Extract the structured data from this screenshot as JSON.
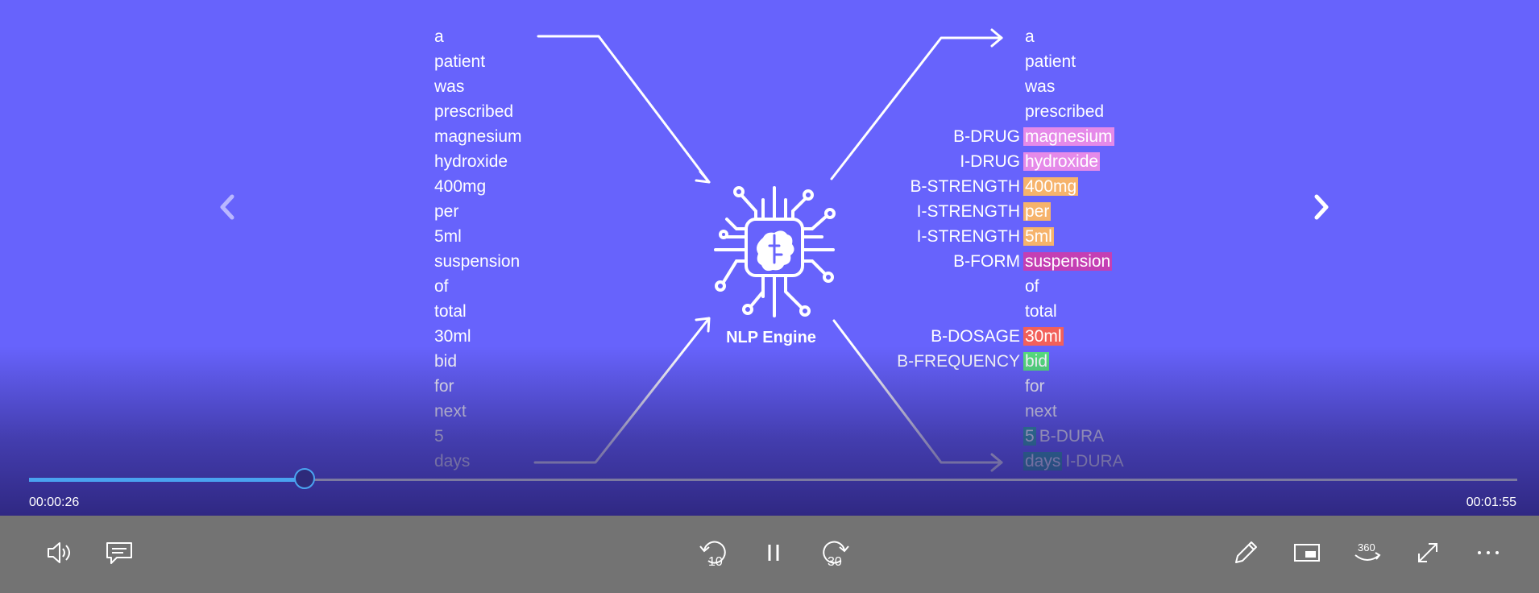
{
  "input_tokens": [
    "a",
    "patient",
    "was",
    "prescribed",
    "magnesium",
    "hydroxide",
    "400mg",
    "per",
    "5ml",
    "suspension",
    "of",
    "total",
    "30ml",
    "bid",
    "for",
    "next",
    "5",
    "days"
  ],
  "output_rows": [
    {
      "token": "a",
      "tag": "",
      "hl": "none",
      "tag_position": "left"
    },
    {
      "token": "patient",
      "tag": "",
      "hl": "none",
      "tag_position": "left"
    },
    {
      "token": "was",
      "tag": "",
      "hl": "none",
      "tag_position": "left"
    },
    {
      "token": "prescribed",
      "tag": "",
      "hl": "none",
      "tag_position": "left"
    },
    {
      "token": "magnesium",
      "tag": "B-DRUG",
      "hl": "drug",
      "tag_position": "left"
    },
    {
      "token": "hydroxide",
      "tag": "I-DRUG",
      "hl": "drug",
      "tag_position": "left"
    },
    {
      "token": "400mg",
      "tag": "B-STRENGTH",
      "hl": "strength",
      "tag_position": "left"
    },
    {
      "token": "per",
      "tag": "I-STRENGTH",
      "hl": "strength",
      "tag_position": "left"
    },
    {
      "token": "5ml",
      "tag": "I-STRENGTH",
      "hl": "strength",
      "tag_position": "left"
    },
    {
      "token": "suspension",
      "tag": "B-FORM",
      "hl": "form",
      "tag_position": "left"
    },
    {
      "token": "of",
      "tag": "",
      "hl": "none",
      "tag_position": "left"
    },
    {
      "token": "total",
      "tag": "",
      "hl": "none",
      "tag_position": "left"
    },
    {
      "token": "30ml",
      "tag": "B-DOSAGE",
      "hl": "dosage",
      "tag_position": "left"
    },
    {
      "token": "bid",
      "tag": "B-FREQUENCY",
      "hl": "freq",
      "tag_position": "left"
    },
    {
      "token": "for",
      "tag": "",
      "hl": "none",
      "tag_position": "left"
    },
    {
      "token": "next",
      "tag": "",
      "hl": "none",
      "tag_position": "left"
    },
    {
      "token": "5",
      "tag": "B-DURA",
      "hl": "dura",
      "tag_position": "right"
    },
    {
      "token": "days",
      "tag": "I-DURA",
      "hl": "dura",
      "tag_position": "right"
    }
  ],
  "engine": {
    "label": "NLP Engine",
    "icon": "brain-chip-icon"
  },
  "player": {
    "elapsed": "00:00:26",
    "duration": "00:01:55",
    "progress_fraction": 0.185,
    "accent_color": "#4aa3f0",
    "skip_back_label": "10",
    "skip_forward_label": "30",
    "view_360_label": "360"
  },
  "colors": {
    "background": "#6763fc",
    "drug": "#e58ae9",
    "strength": "#f6b36b",
    "form": "#c43fb4",
    "dosage": "#f2605a",
    "freq": "#56e07c",
    "dura": "#2ea7a3"
  },
  "icons": [
    "volume-icon",
    "captions-icon",
    "rewind-10-icon",
    "pause-icon",
    "forward-30-icon",
    "pen-icon",
    "mini-view-icon",
    "view-360-icon",
    "fullscreen-icon",
    "more-options-icon",
    "previous-slide-icon",
    "next-slide-icon"
  ]
}
